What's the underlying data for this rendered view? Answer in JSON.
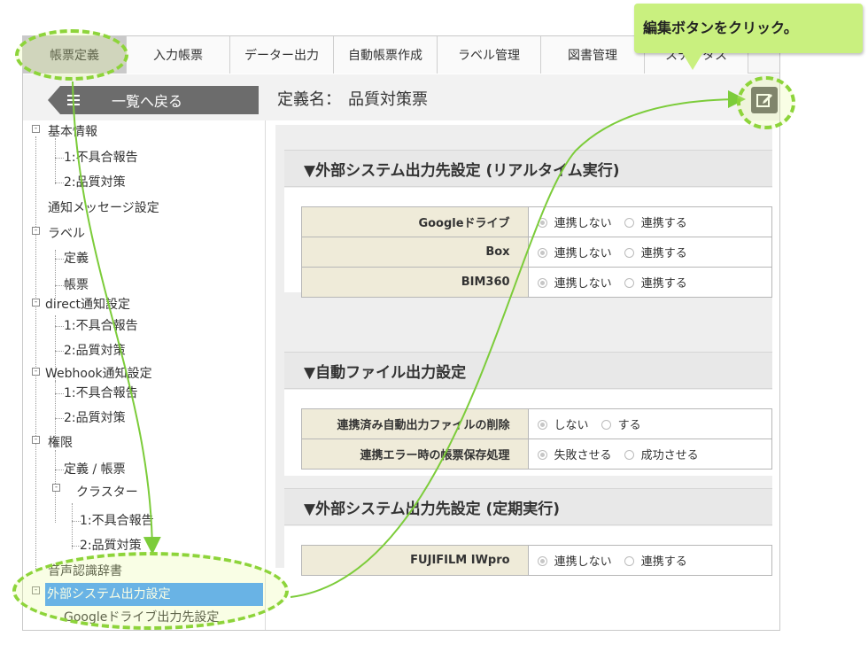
{
  "tabs": [
    {
      "label": "帳票定義",
      "active": true
    },
    {
      "label": "入力帳票",
      "active": false
    },
    {
      "label": "データー出力",
      "active": false
    },
    {
      "label": "自動帳票作成",
      "active": false
    },
    {
      "label": "ラベル管理",
      "active": false
    },
    {
      "label": "図書管理",
      "active": false
    },
    {
      "label": "ステータス",
      "active": false
    }
  ],
  "header": {
    "back_label": "一覧へ戻る",
    "def_prefix": "定義名：",
    "def_value": "品質対策票"
  },
  "callout": {
    "text": "編集ボタンをクリック。"
  },
  "sidebar": {
    "basic": "基本情報",
    "basic_1": "1:不具合報告",
    "basic_2": "2:品質対策",
    "notify_msg": "通知メッセージ設定",
    "label": "ラベル",
    "label_def": "定義",
    "label_form": "帳票",
    "direct": "direct通知設定",
    "direct_1": "1:不具合報告",
    "direct_2": "2:品質対策",
    "webhook": "Webhook通知設定",
    "webhook_1": "1:不具合報告",
    "webhook_2": "2:品質対策",
    "perm": "権限",
    "perm_def": "定義 / 帳票",
    "cluster": "クラスター",
    "cluster_1": "1:不具合報告",
    "cluster_2": "2:品質対策",
    "voice": "音声認識辞書",
    "ext": "外部システム出力設定",
    "gdrive": "Googleドライブ出力先設定"
  },
  "sections": {
    "realtime": {
      "title": "▼外部システム出力先設定 (リアルタイム実行)",
      "rows": [
        {
          "label": "Googleドライブ",
          "opt1": "連携しない",
          "opt2": "連携する"
        },
        {
          "label": "Box",
          "opt1": "連携しない",
          "opt2": "連携する"
        },
        {
          "label": "BIM360",
          "opt1": "連携しない",
          "opt2": "連携する"
        }
      ]
    },
    "auto": {
      "title": "▼自動ファイル出力設定",
      "rows": [
        {
          "label": "連携済み自動出力ファイルの削除",
          "opt1": "しない",
          "opt2": "する"
        },
        {
          "label": "連携エラー時の帳票保存処理",
          "opt1": "失敗させる",
          "opt2": "成功させる"
        }
      ]
    },
    "periodic": {
      "title": "▼外部システム出力先設定 (定期実行)",
      "rows": [
        {
          "label": "FUJIFILM IWpro",
          "opt1": "連携しない",
          "opt2": "連携する"
        }
      ]
    }
  },
  "colors": {
    "highlight": "#8dd43a",
    "arrow": "#7ccc3a",
    "callout_bg": "#c9f07f",
    "selected": "#3f9bff",
    "label_cell": "#efebd9"
  }
}
